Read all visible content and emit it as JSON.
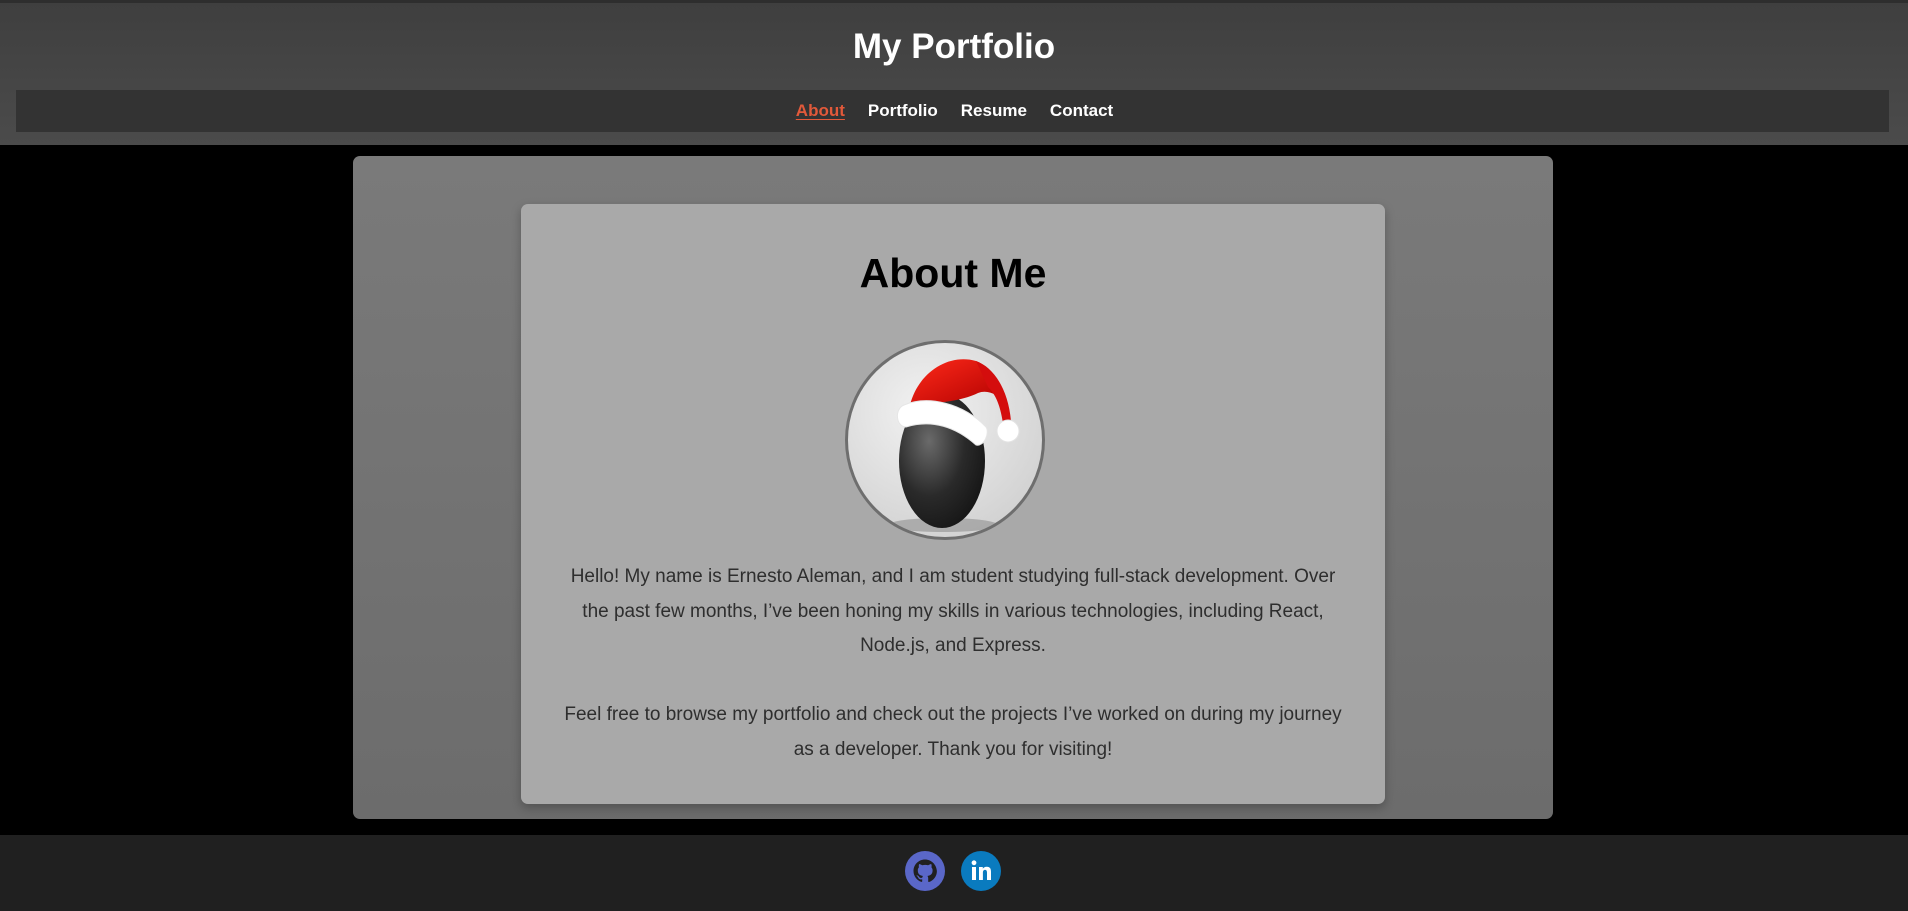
{
  "header": {
    "title": "My Portfolio"
  },
  "nav": {
    "items": [
      {
        "label": "About",
        "active": true
      },
      {
        "label": "Portfolio",
        "active": false
      },
      {
        "label": "Resume",
        "active": false
      },
      {
        "label": "Contact",
        "active": false
      }
    ]
  },
  "about": {
    "heading": "About Me",
    "avatar_icon": "egg-with-santa-hat",
    "paragraph_1": "Hello! My name is Ernesto Aleman, and I am student studying full-stack development. Over the past few months, I’ve been honing my skills in various technologies, including React, Node.js, and Express.",
    "paragraph_2": "Feel free to browse my portfolio and check out the projects I’ve worked on during my journey as a developer. Thank you for visiting!"
  },
  "footer": {
    "links": [
      {
        "icon": "github-icon",
        "color": "#5a67c8"
      },
      {
        "icon": "linkedin-icon",
        "color": "#0a7bbf"
      }
    ]
  },
  "colors": {
    "accent": "#e2593a",
    "header_bg": "#444444",
    "nav_bg": "#333333",
    "panel_bg": "#737373",
    "card_bg": "#a9a9a9",
    "footer_bg": "#202020"
  }
}
